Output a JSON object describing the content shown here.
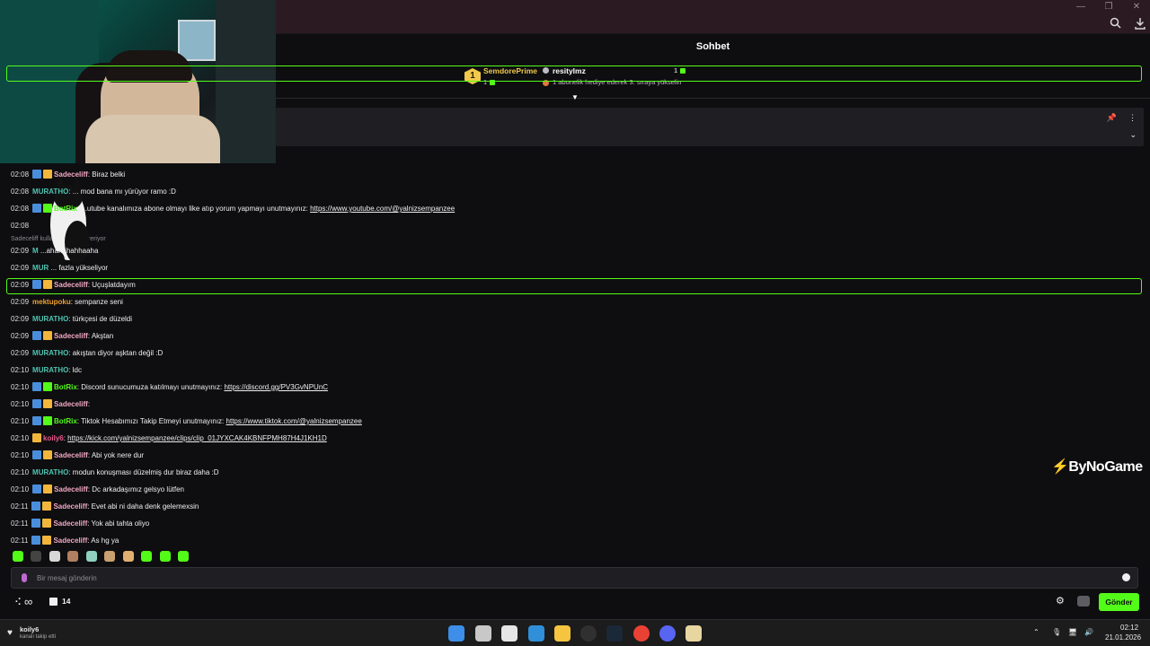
{
  "chat": {
    "header": "Sohbet",
    "leaderboard": {
      "first": {
        "rank": "1",
        "name": "SemdorePrime",
        "count": "1"
      },
      "second": {
        "name": "resitylmz",
        "count": "1",
        "hint": "1 abonelik hediye ederek 3. sıraya yükselin"
      }
    },
    "reply_hint": "Sadeceliff  kullanıcıya yanıt veriyor",
    "messages": [
      {
        "time": "02:08",
        "badges": [
          "mod",
          "sub"
        ],
        "user": "Sadeceliff",
        "user_color": "#f2a7c3",
        "text": ": Biraz belki"
      },
      {
        "time": "02:08",
        "badges": [],
        "user": "MURATHO",
        "user_color": "#4fc3b1",
        "text": ": ... mod bana mı yürüyor ramo :D"
      },
      {
        "time": "02:08",
        "badges": [
          "mod",
          "bot"
        ],
        "user": "BotRix",
        "user_color": "#53fc18",
        "text": ": ...utube kanalımıza abone olmayı like atıp yorum yapmayı unutmayınız: ",
        "link": "https://www.youtube.com/@yalnizsempanzee",
        "highlight": true
      },
      {
        "time": "02:08",
        "badges": [],
        "user": "",
        "user_color": "#efeff1",
        "text": ""
      },
      {
        "time": "02:09",
        "badges": [],
        "user": "M",
        "user_color": "#4fc3b1",
        "text": " ...ahahahahhaaha"
      },
      {
        "time": "02:09",
        "badges": [],
        "user": "MUR",
        "user_color": "#4fc3b1",
        "text": " ... fazla yükseliyor"
      },
      {
        "time": "02:09",
        "badges": [
          "mod",
          "sub"
        ],
        "user": "Sadeceliff",
        "user_color": "#f2a7c3",
        "text": ": Uçuşlatdayım"
      },
      {
        "time": "02:09",
        "badges": [],
        "user": "mektupoku",
        "user_color": "#f0a030",
        "text": ": sempanze seni"
      },
      {
        "time": "02:09",
        "badges": [],
        "user": "MURATHO",
        "user_color": "#4fc3b1",
        "text": ": türkçesi de düzeldi"
      },
      {
        "time": "02:09",
        "badges": [
          "mod",
          "sub"
        ],
        "user": "Sadeceliff",
        "user_color": "#f2a7c3",
        "text": ": Akştan"
      },
      {
        "time": "02:09",
        "badges": [],
        "user": "MURATHO",
        "user_color": "#4fc3b1",
        "text": ": akıştan diyor aşktan değil :D"
      },
      {
        "time": "02:10",
        "badges": [],
        "user": "MURATHO",
        "user_color": "#4fc3b1",
        "text": ": ldc"
      },
      {
        "time": "02:10",
        "badges": [
          "mod",
          "bot"
        ],
        "user": "BotRix",
        "user_color": "#53fc18",
        "text": ": Discord sunucumuza katılmayı unutmayınız: ",
        "link": "https://discord.gg/PV3GvNPUnC"
      },
      {
        "time": "02:10",
        "badges": [
          "mod",
          "sub"
        ],
        "user": "Sadeceliff",
        "user_color": "#f2a7c3",
        "text": ":"
      },
      {
        "time": "02:10",
        "badges": [
          "mod",
          "bot"
        ],
        "user": "BotRix",
        "user_color": "#53fc18",
        "text": ": Tiktok Hesabımızı Takip Etmeyi unutmayınız: ",
        "link": "https://www.tiktok.com/@yalnizsempanzee",
        "highlight": true
      },
      {
        "time": "02:10",
        "badges": [
          "sub"
        ],
        "user": "koily6",
        "user_color": "#e85a8a",
        "text": ": ",
        "link": "https://kick.com/yalnizsempanzee/clips/clip_01JYXCAK4KBNFPMH87H4J1KH1D"
      },
      {
        "time": "02:10",
        "badges": [
          "mod",
          "sub"
        ],
        "user": "Sadeceliff",
        "user_color": "#f2a7c3",
        "text": ": Abi yok nere dur"
      },
      {
        "time": "02:10",
        "badges": [],
        "user": "MURATHO",
        "user_color": "#4fc3b1",
        "text": ": modun konuşması düzelmiş dur biraz daha :D"
      },
      {
        "time": "02:10",
        "badges": [
          "mod",
          "sub"
        ],
        "user": "Sadeceliff",
        "user_color": "#f2a7c3",
        "text": ": Dc arkadaşımız gelsyo lütfen"
      },
      {
        "time": "02:11",
        "badges": [
          "mod",
          "sub"
        ],
        "user": "Sadeceliff",
        "user_color": "#f2a7c3",
        "text": ": Evet abi ni daha denk gelemexsin"
      },
      {
        "time": "02:11",
        "badges": [
          "mod",
          "sub"
        ],
        "user": "Sadeceliff",
        "user_color": "#f2a7c3",
        "text": ": Yok abi tahta oliyo"
      },
      {
        "time": "02:11",
        "badges": [
          "mod",
          "sub"
        ],
        "user": "Sadeceliff",
        "user_color": "#f2a7c3",
        "text": ": As hg ya"
      }
    ],
    "input_placeholder": "Bir mesaj gönderin",
    "footer": {
      "infinity": "∞",
      "store_count": "14",
      "send_label": "Gönder"
    }
  },
  "overlay": {
    "brand": "ByNoGame"
  },
  "taskbar": {
    "notification_user": "koily6",
    "notification_text": "kanalı takip etti",
    "time": "02:12",
    "date": "21.01.2026"
  },
  "colors": {
    "accent": "#53fc18",
    "background": "#0e0e10",
    "mod_badge": "#4a8edb",
    "sub_badge": "#f2b63c"
  }
}
